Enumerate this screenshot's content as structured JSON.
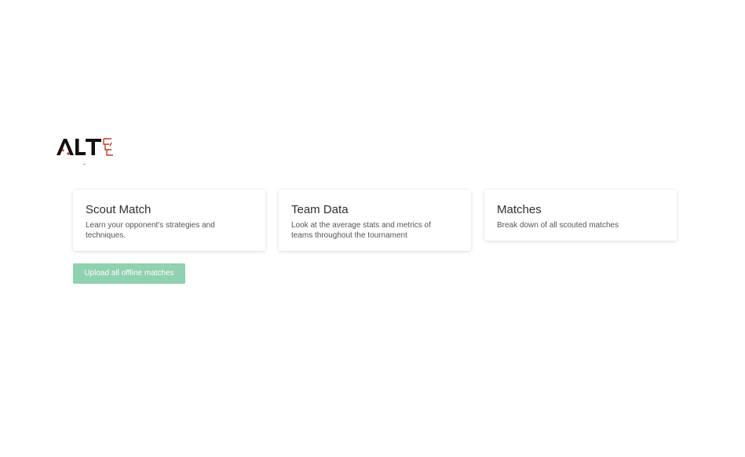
{
  "brand": {
    "logo_alt": "ALT logo",
    "accent_color": "#c0392b",
    "text_color": "#111111"
  },
  "cards": [
    {
      "title": "Scout Match",
      "description": "Learn your opponent's strategies and techniques."
    },
    {
      "title": "Team Data",
      "description": "Look at the average stats and metrics of teams throughout the tournament"
    },
    {
      "title": "Matches",
      "description": "Break down of all scouted matches"
    }
  ],
  "upload_button": {
    "label": "Upload all offline matches",
    "color": "#8fd1b0"
  }
}
